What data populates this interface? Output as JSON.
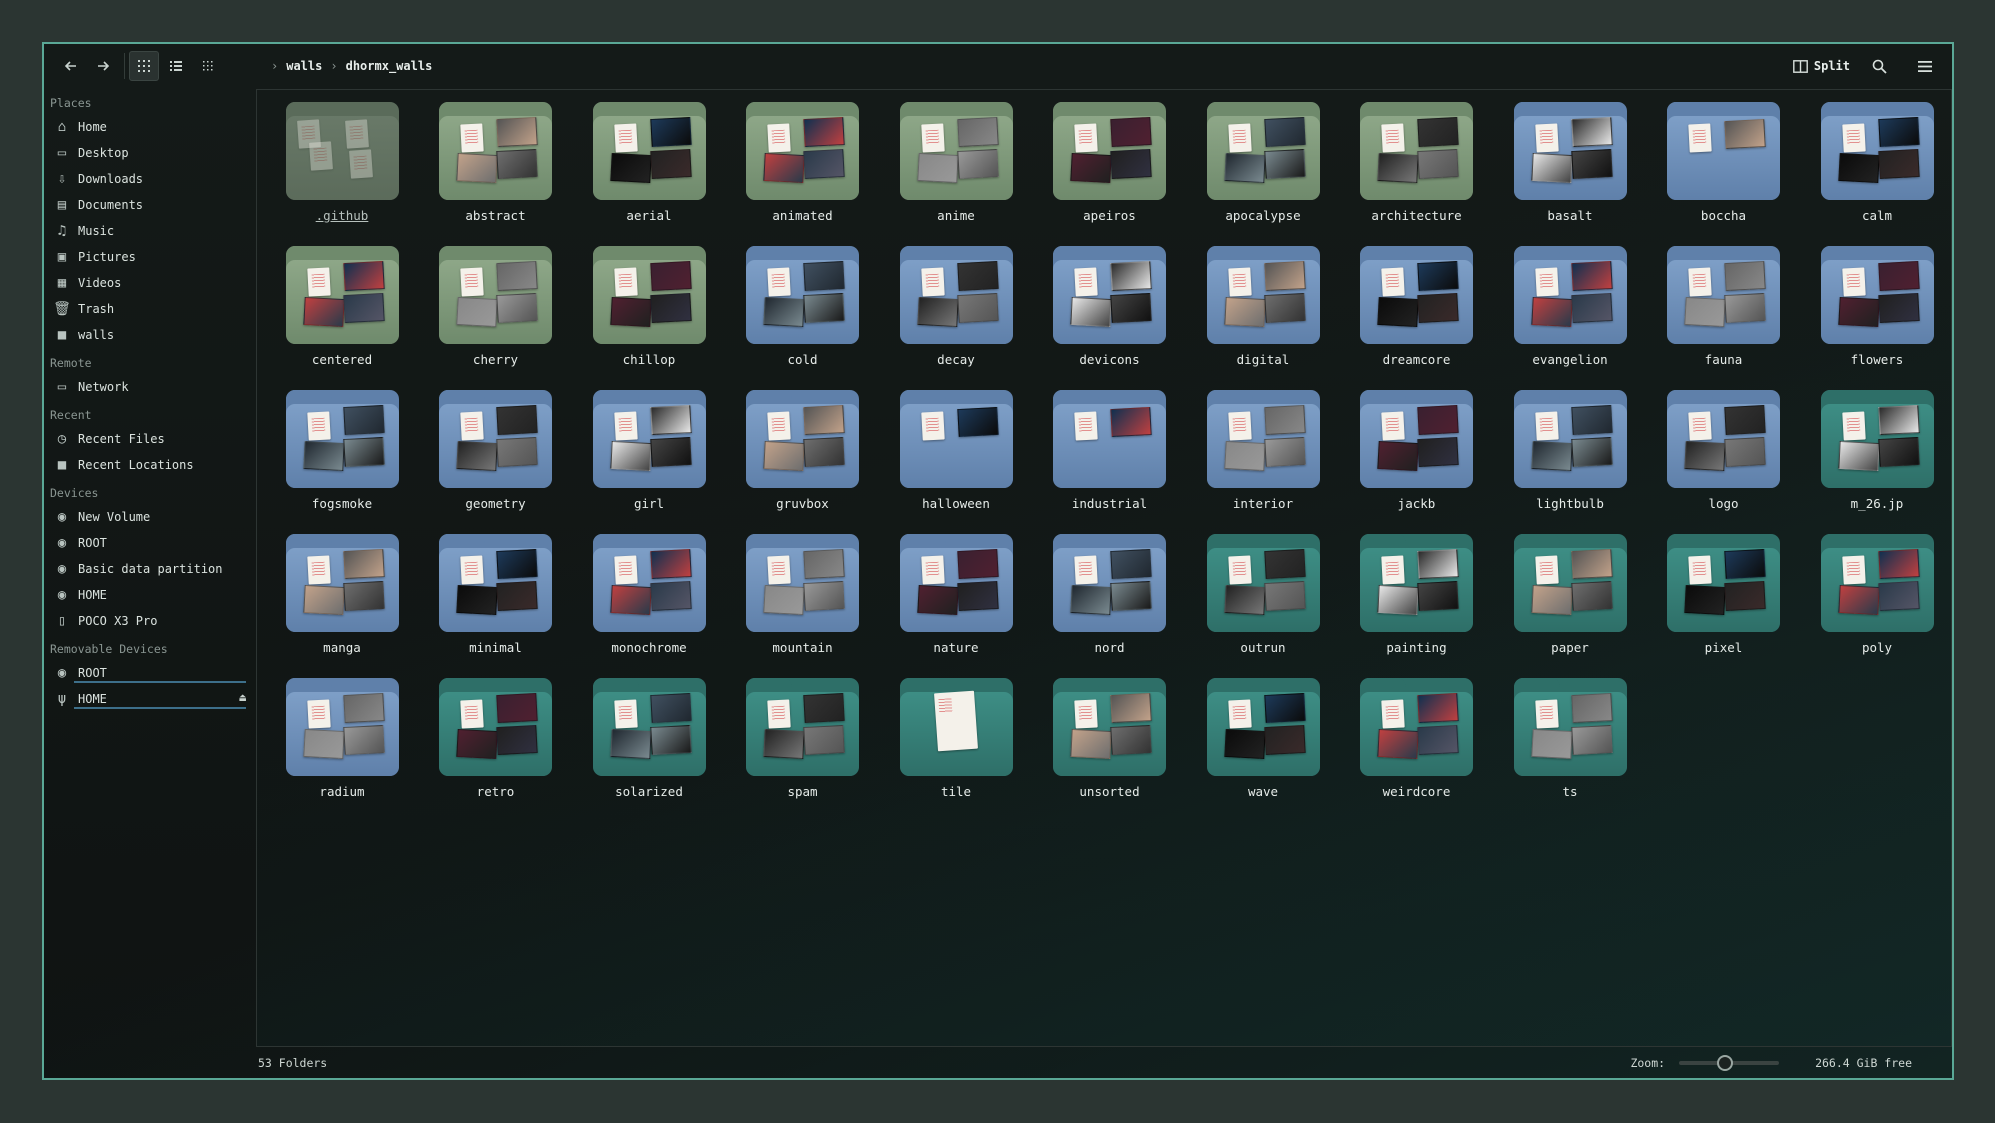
{
  "toolbar": {
    "back_icon": "arrow-left-icon",
    "forward_icon": "arrow-right-icon",
    "breadcrumb": [
      "walls",
      "dhormx_walls"
    ],
    "split_label": "Split"
  },
  "sidebar": {
    "sections": [
      {
        "header": "Places",
        "items": [
          {
            "label": "Home",
            "icon": "home-icon"
          },
          {
            "label": "Desktop",
            "icon": "desktop-icon"
          },
          {
            "label": "Downloads",
            "icon": "download-icon"
          },
          {
            "label": "Documents",
            "icon": "document-icon"
          },
          {
            "label": "Music",
            "icon": "music-icon"
          },
          {
            "label": "Pictures",
            "icon": "picture-icon"
          },
          {
            "label": "Videos",
            "icon": "video-icon"
          },
          {
            "label": "Trash",
            "icon": "trash-icon"
          },
          {
            "label": "walls",
            "icon": "folder-icon"
          }
        ]
      },
      {
        "header": "Remote",
        "items": [
          {
            "label": "Network",
            "icon": "network-icon"
          }
        ]
      },
      {
        "header": "Recent",
        "items": [
          {
            "label": "Recent Files",
            "icon": "clock-icon"
          },
          {
            "label": "Recent Locations",
            "icon": "folder-icon"
          }
        ]
      },
      {
        "header": "Devices",
        "items": [
          {
            "label": "New Volume",
            "icon": "drive-icon"
          },
          {
            "label": "ROOT",
            "icon": "drive-icon"
          },
          {
            "label": "Basic data partition",
            "icon": "drive-icon"
          },
          {
            "label": "HOME",
            "icon": "drive-icon"
          },
          {
            "label": "POCO X3 Pro",
            "icon": "phone-icon"
          }
        ]
      },
      {
        "header": "Removable Devices",
        "items": [
          {
            "label": "ROOT",
            "icon": "drive-icon"
          },
          {
            "label": "HOME",
            "icon": "usb-icon"
          }
        ]
      }
    ]
  },
  "folders": [
    ".github",
    "abstract",
    "aerial",
    "animated",
    "anime",
    "apeiros",
    "apocalypse",
    "architecture",
    "basalt",
    "boccha",
    "calm",
    "centered",
    "cherry",
    "chillop",
    "cold",
    "decay",
    "devicons",
    "digital",
    "dreamcore",
    "evangelion",
    "fauna",
    "flowers",
    "fogsmoke",
    "geometry",
    "girl",
    "gruvbox",
    "halloween",
    "industrial",
    "interior",
    "jackb",
    "lightbulb",
    "logo",
    "m_26.jp",
    "manga",
    "minimal",
    "monochrome",
    "mountain",
    "nature",
    "nord",
    "outrun",
    "painting",
    "paper",
    "pixel",
    "poly",
    "radium",
    "retro",
    "solarized",
    "spam",
    "tile",
    "unsorted",
    "wave",
    "weirdcore",
    "ts"
  ],
  "status": {
    "count": "53 Folders",
    "zoom_label": "Zoom:",
    "zoom_level": 0.45,
    "free_space": "266.4 GiB free"
  },
  "colors": {
    "accent": "#5aa896",
    "folder_green": "#8fa889",
    "folder_blue": "#7fa0c8",
    "folder_teal": "#3e8f86"
  }
}
